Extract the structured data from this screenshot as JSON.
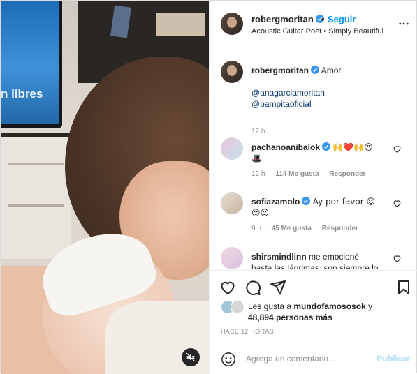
{
  "media": {
    "screen_text": "n libres",
    "mute_icon": "speaker-muted-icon"
  },
  "header": {
    "username": "robergmoritan",
    "separator": "•",
    "follow_label": "Seguir",
    "subtitle": "Acoustic Guitar Poet • Simply Beautiful",
    "more_icon": "more-horizontal-icon",
    "verified_color": "#3897f0"
  },
  "caption": {
    "username": "robergmoritan",
    "text": "Amor.",
    "mention1": "@anagarciamoritan",
    "mention2": "@pampitaoficial",
    "time": "12 h"
  },
  "comments": [
    {
      "username": "pachanoanibalok",
      "text": "🙌❤️🙌😍",
      "text2": "🎩",
      "time": "12 h",
      "likes": "114 Me gusta",
      "reply": "Responder"
    },
    {
      "username": "sofiazamolo",
      "text": "Ay por favor 😍",
      "text2": "😍😍",
      "time": "9 h",
      "likes": "45 Me gusta",
      "reply": "Responder"
    },
    {
      "username": "shirsmindlinn",
      "text": "me emocioné",
      "text2": "hasta las lágrimas, son siempre lo"
    }
  ],
  "likes": {
    "prefix": "Les gusta a ",
    "user": "mundofamososok",
    "connector": " y",
    "count": "48,894 personas más"
  },
  "time_ago": "HACE 12 HORAS",
  "add_comment": {
    "placeholder": "Agrega un comentario...",
    "post_label": "Publicar"
  },
  "colors": {
    "link": "#00376b",
    "accent": "#0095f6",
    "muted": "#8e8e8e"
  }
}
